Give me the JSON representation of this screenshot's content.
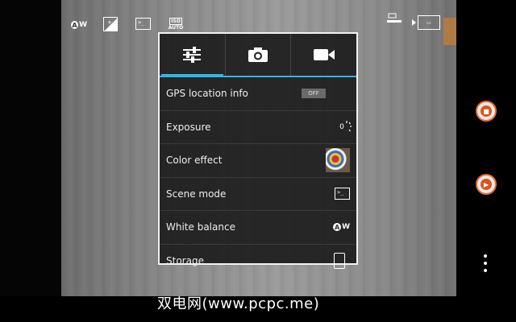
{
  "status_bar": {
    "white_balance_icon": "wb-auto-icon",
    "white_balance_text": "W",
    "exposure_icon": "exposure-icon",
    "scene_icon": "scene-mode-icon",
    "iso_icon": "iso-auto-icon",
    "iso_label": "ISO",
    "iso_value": "AUTO",
    "size_icon": "picture-size-icon",
    "switch_icon": "switch-camera-icon"
  },
  "tabs": [
    {
      "icon": "settings-sliders-icon",
      "active": true
    },
    {
      "icon": "camera-icon",
      "active": false
    },
    {
      "icon": "video-camera-icon",
      "active": false
    }
  ],
  "settings": [
    {
      "label": "GPS location info",
      "value": "OFF"
    },
    {
      "label": "Exposure",
      "value": "0"
    },
    {
      "label": "Color effect",
      "value_icon": "color-effect-thumbnail"
    },
    {
      "label": "Scene mode",
      "value_icon": "scene-mode-icon"
    },
    {
      "label": "White balance",
      "value_icon": "wb-auto-icon",
      "value_text": "W"
    },
    {
      "label": "Storage",
      "value_icon": "storage-device-icon"
    }
  ],
  "controls": {
    "photo_shutter_icon": "camera-shutter-icon",
    "video_shutter_icon": "video-shutter-icon",
    "overflow_icon": "overflow-menu-icon"
  },
  "colors": {
    "accent": "#33b5e5",
    "shutter_ring": "#e86a2b",
    "panel_bg": "#1c1c1c"
  },
  "watermark": "双电网(www.pcpc.me)"
}
